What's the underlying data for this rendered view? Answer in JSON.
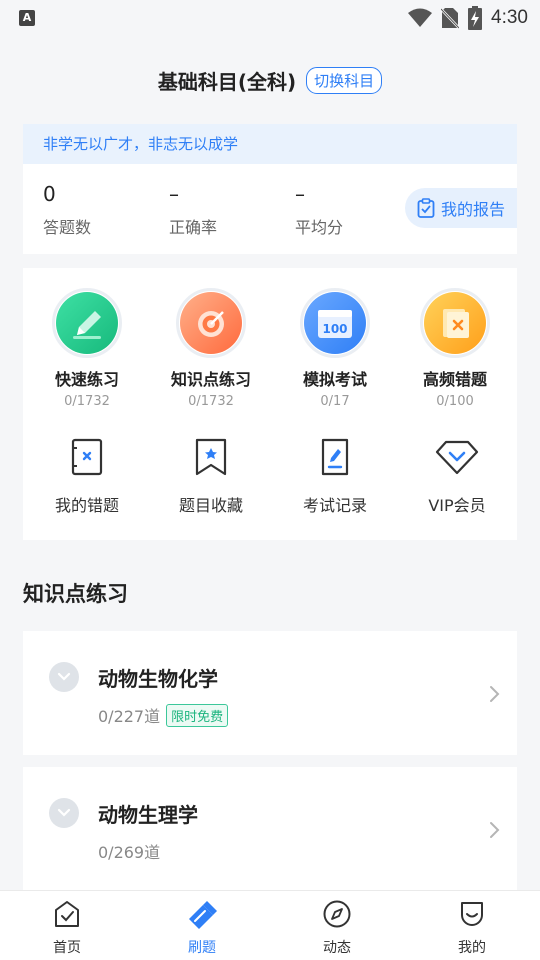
{
  "status_bar": {
    "time": "4:30",
    "app_glyph": "A"
  },
  "header": {
    "title": "基础科目(全科)",
    "switch_label": "切换科目"
  },
  "stats": {
    "motto": "非学无以广才，非志无以成学",
    "items": [
      {
        "value": "0",
        "label": "答题数"
      },
      {
        "value": "–",
        "label": "正确率"
      },
      {
        "value": "–",
        "label": "平均分"
      }
    ],
    "report_label": "我的报告"
  },
  "features": [
    {
      "label": "快速练习",
      "count": "0/1732",
      "icon": "pencil-icon",
      "color": "#1fc98e"
    },
    {
      "label": "知识点练习",
      "count": "0/1732",
      "icon": "target-icon",
      "color": "#ff7a45"
    },
    {
      "label": "模拟考试",
      "count": "0/17",
      "icon": "calendar-100-icon",
      "color": "#3b86f7"
    },
    {
      "label": "高频错题",
      "count": "0/100",
      "icon": "error-book-icon",
      "color": "#ffb020"
    }
  ],
  "tools": [
    {
      "label": "我的错题",
      "icon": "wrong-book-icon"
    },
    {
      "label": "题目收藏",
      "icon": "bookmark-star-icon"
    },
    {
      "label": "考试记录",
      "icon": "exam-record-icon"
    },
    {
      "label": "VIP会员",
      "icon": "diamond-icon"
    }
  ],
  "section": {
    "title": "知识点练习"
  },
  "topics": [
    {
      "name": "动物生物化学",
      "count": "0/227道",
      "badge": "限时免费"
    },
    {
      "name": "动物生理学",
      "count": "0/269道",
      "badge": ""
    }
  ],
  "tabs": [
    {
      "label": "首页",
      "icon": "home-check-icon",
      "active": false
    },
    {
      "label": "刷题",
      "icon": "brush-icon",
      "active": true
    },
    {
      "label": "动态",
      "icon": "compass-icon",
      "active": false
    },
    {
      "label": "我的",
      "icon": "profile-icon",
      "active": false
    }
  ],
  "colors": {
    "accent": "#2f7ff6",
    "free_badge": "#1cb47e"
  }
}
